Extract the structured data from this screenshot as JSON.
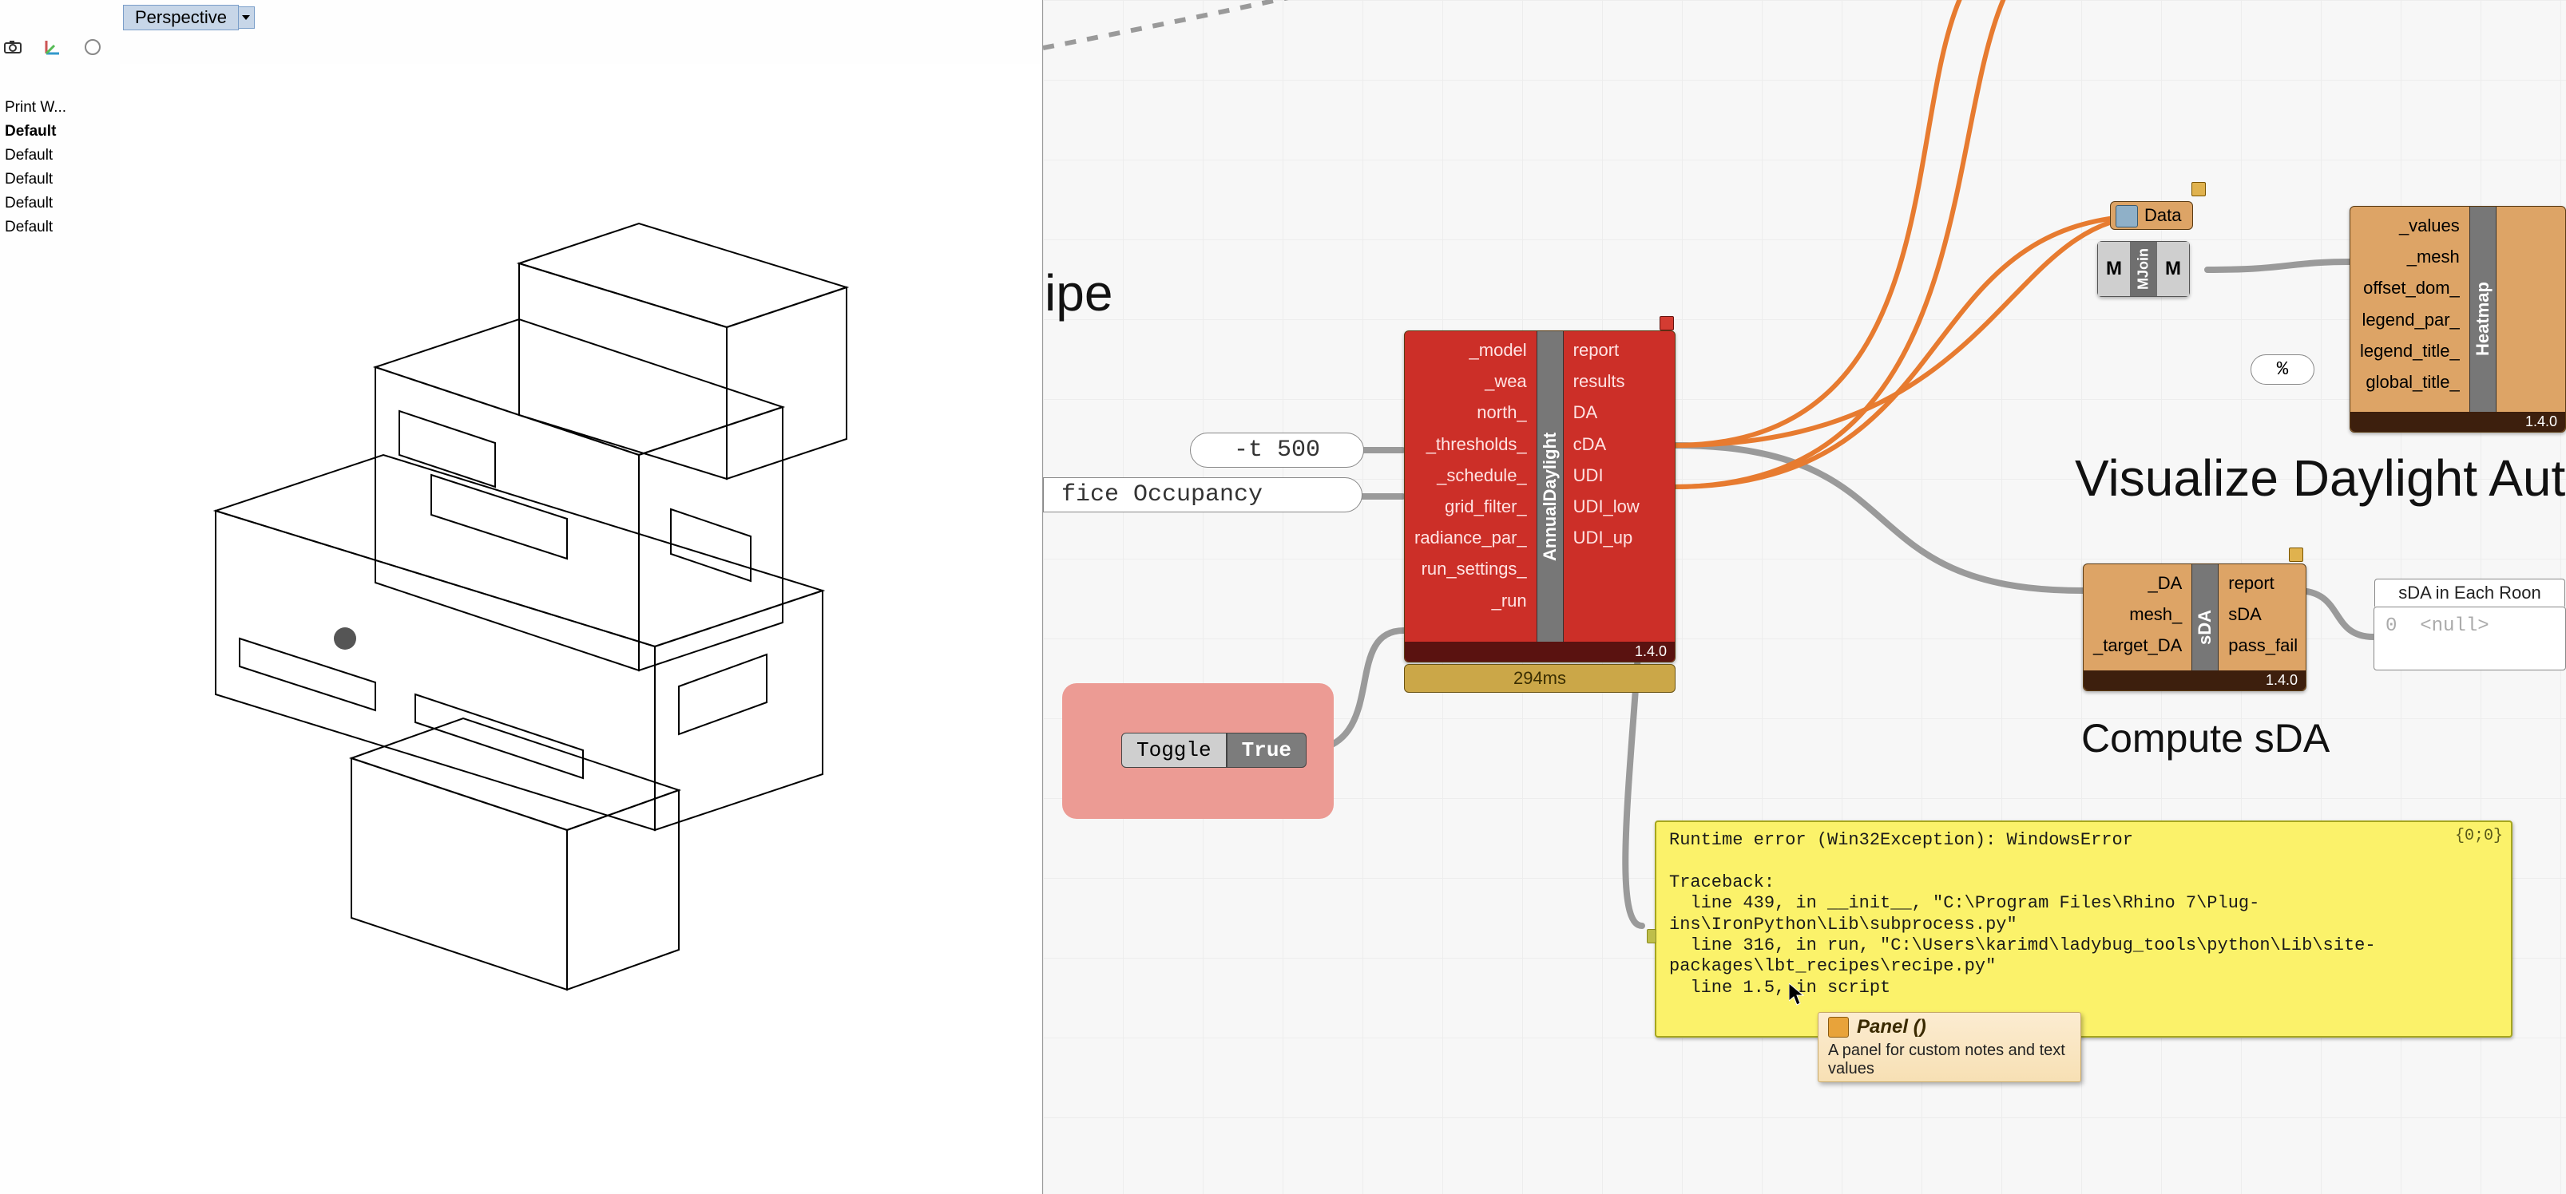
{
  "viewport": {
    "tab_label": "Perspective",
    "named_views": [
      "Print W...",
      "Default",
      "Default",
      "Default",
      "Default",
      "Default"
    ]
  },
  "canvas": {
    "scribble_recipe_fragment": "ipe",
    "scribble_visualize": "Visualize Daylight Autor",
    "scribble_compute": "Compute sDA",
    "panel_t500": "-t 500",
    "panel_occupancy": "fice Occupancy",
    "toggle": {
      "label": "Toggle",
      "value": "True"
    },
    "pct_bubble": "%",
    "nodes": {
      "annual_daylight": {
        "name": "AnnualDaylight",
        "inputs": [
          "_model",
          "_wea",
          "north_",
          "_thresholds_",
          "_schedule_",
          "grid_filter_",
          "radiance_par_",
          "run_settings_",
          "_run"
        ],
        "outputs": [
          "report",
          "results",
          "DA",
          "cDA",
          "UDI",
          "UDI_low",
          "UDI_up"
        ],
        "version": "1.4.0",
        "timer": "294ms"
      },
      "mjoin": {
        "left": "M",
        "mid": "MJoin",
        "right": "M"
      },
      "data_param": "Data",
      "heatmap": {
        "name": "Heatmap",
        "inputs": [
          "_values",
          "_mesh",
          "offset_dom_",
          "legend_par_",
          "legend_title_",
          "global_title_"
        ],
        "version": "1.4.0"
      },
      "sda": {
        "name": "sDA",
        "inputs": [
          "_DA",
          "mesh_",
          "_target_DA"
        ],
        "outputs": [
          "report",
          "sDA",
          "pass_fail"
        ],
        "version": "1.4.0"
      }
    },
    "sda_out_panel": {
      "header": "sDA in Each Roon",
      "index": "0",
      "value": "<null>"
    },
    "error_panel": {
      "path": "{0;0}",
      "text": "Runtime error (Win32Exception): WindowsError\n\nTraceback:\n  line 439, in __init__, \"C:\\Program Files\\Rhino 7\\Plug-ins\\IronPython\\Lib\\subprocess.py\"\n  line 316, in run, \"C:\\Users\\karimd\\ladybug_tools\\python\\Lib\\site-packages\\lbt_recipes\\recipe.py\"\n  line 1.5, in script"
    },
    "tooltip": {
      "title": "Panel ()",
      "desc": "A panel for custom notes and text values"
    }
  }
}
